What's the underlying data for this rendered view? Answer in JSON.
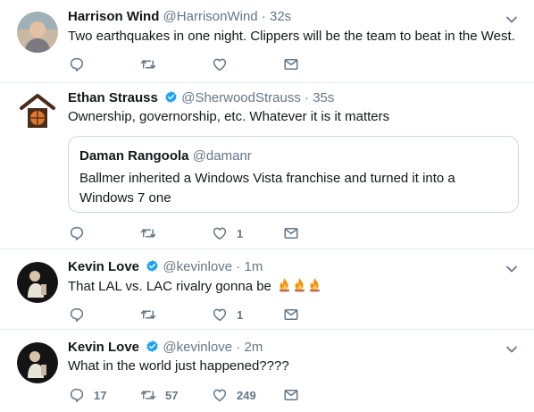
{
  "tweets": [
    {
      "name": "Harrison Wind",
      "handle": "@HarrisonWind",
      "sep": "·",
      "time": "32s",
      "text": "Two earthquakes in one night. Clippers will be the team to beat in the West.",
      "reply_count": "",
      "retweet_count": "",
      "like_count": "",
      "verified": false
    },
    {
      "name": "Ethan Strauss",
      "handle": "@SherwoodStrauss",
      "sep": "·",
      "time": "35s",
      "text": "Ownership, governorship, etc. Whatever it is it matters",
      "quote": {
        "name": "Daman Rangoola",
        "handle": "@damanr",
        "text": "Ballmer inherited a Windows Vista franchise and turned it into a Windows 7 one"
      },
      "reply_count": "",
      "retweet_count": "",
      "like_count": "1",
      "verified": true
    },
    {
      "name": "Kevin Love",
      "handle": "@kevinlove",
      "sep": "·",
      "time": "1m",
      "text": "That LAL vs. LAC rivalry gonna be",
      "emoji": "fire-emoji x3",
      "reply_count": "",
      "retweet_count": "",
      "like_count": "1",
      "verified": true
    },
    {
      "name": "Kevin Love",
      "handle": "@kevinlove",
      "sep": "·",
      "time": "2m",
      "text": "What in the world just happened????",
      "reply_count": "17",
      "retweet_count": "57",
      "like_count": "249",
      "verified": true
    }
  ],
  "colors": {
    "text": "#14171a",
    "secondary": "#657786",
    "verified": "#1da1f2",
    "divider": "#e6ecf0"
  },
  "icons": [
    "reply-icon",
    "retweet-icon",
    "like-icon",
    "message-icon",
    "chevron-down-icon",
    "verified-icon"
  ]
}
